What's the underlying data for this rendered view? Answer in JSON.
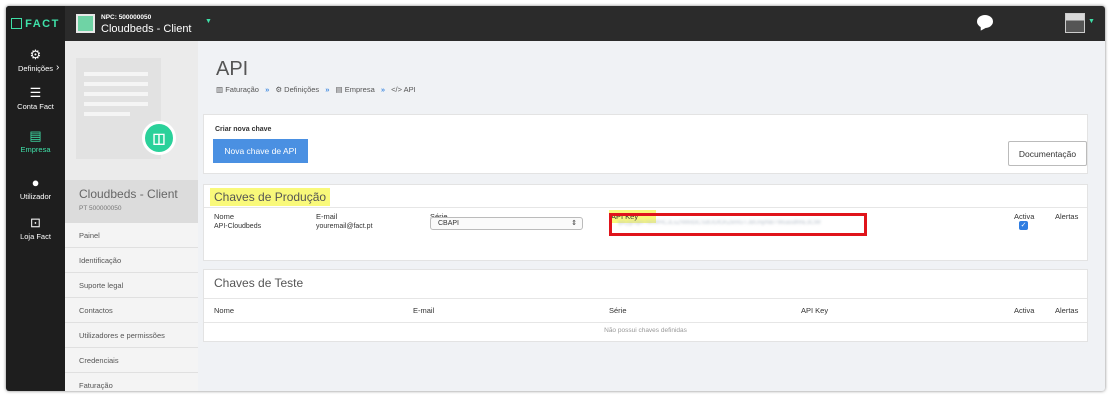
{
  "topbar": {
    "logo": "FACT",
    "company_nif": "NPC: 500000050",
    "company_name": "Cloudbeds - Client"
  },
  "leftnav": {
    "items": [
      {
        "label": "Definições",
        "icon": "gears-icon"
      },
      {
        "label": "Conta Fact",
        "icon": "menu-icon"
      },
      {
        "label": "Empresa",
        "icon": "building-icon"
      },
      {
        "label": "Utilizador",
        "icon": "user-icon"
      },
      {
        "label": "Loja Fact",
        "icon": "store-icon"
      }
    ]
  },
  "sidebar": {
    "client_name": "Cloudbeds - Client",
    "client_nif": "PT 500000050",
    "items": [
      "Painel",
      "Identificação",
      "Suporte legal",
      "Contactos",
      "Utilizadores e permissões",
      "Credenciais",
      "Faturação"
    ]
  },
  "page": {
    "title": "API",
    "breadcrumb": [
      "Faturação",
      "Definições",
      "Empresa",
      "API"
    ]
  },
  "newkey": {
    "label": "Criar nova chave",
    "button": "Nova chave de API",
    "doc_button": "Documentação"
  },
  "production": {
    "title": "Chaves de Produção",
    "headers": [
      "Nome",
      "E-mail",
      "Série",
      "API Key",
      "Activa",
      "Alertas"
    ],
    "row": {
      "name": "API-Cloudbeds",
      "email": "youremail@fact.pt",
      "serie": "CBAPI",
      "api_key": "ljaQgnqeFNkWHCJLsZNWd3CSdUGfOnZkmGTJBUnpNBTWuasdhhE3C9lr",
      "active": true
    }
  },
  "test": {
    "title": "Chaves de Teste",
    "headers": [
      "Nome",
      "E-mail",
      "Série",
      "API Key",
      "Activa",
      "Alertas"
    ],
    "empty": "Não possui chaves definidas"
  },
  "colors": {
    "accent": "#3fe0a8",
    "primary_button": "#4a90e2",
    "highlight": "#f9f97a",
    "red_box": "#e0141b"
  }
}
